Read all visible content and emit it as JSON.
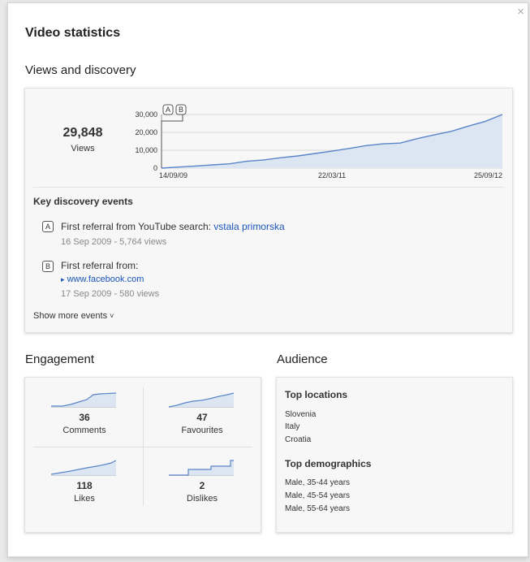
{
  "dialog": {
    "title": "Video statistics",
    "close_glyph": "×"
  },
  "views_section": {
    "heading": "Views and discovery",
    "views_count": "29,848",
    "views_label": "Views"
  },
  "chart_data": {
    "type": "area",
    "x_tick_labels": [
      "14/09/09",
      "22/03/11",
      "25/09/12"
    ],
    "y_tick_labels": [
      "0",
      "10,000",
      "20,000",
      "30,000"
    ],
    "ylim": [
      0,
      30000
    ],
    "x": [
      0,
      0.05,
      0.1,
      0.15,
      0.2,
      0.25,
      0.3,
      0.35,
      0.4,
      0.45,
      0.5,
      0.55,
      0.6,
      0.65,
      0.7,
      0.75,
      0.8,
      0.85,
      0.9,
      0.95,
      1.0
    ],
    "values": [
      0,
      600,
      1200,
      1800,
      2400,
      3800,
      4600,
      5800,
      6800,
      8200,
      9500,
      11000,
      12600,
      13600,
      14000,
      16500,
      18600,
      20600,
      23500,
      26200,
      30000
    ],
    "series_color": "#5a85c8",
    "fill_color": "#dce6f2",
    "markers": [
      "A",
      "B"
    ],
    "grid": true
  },
  "discovery": {
    "title": "Key discovery events",
    "events": [
      {
        "marker": "A",
        "text": "First referral from YouTube search: ",
        "link": "vstala primorska",
        "sub": "16 Sep 2009 - 5,764 views"
      },
      {
        "marker": "B",
        "text": "First referral from:",
        "link_arrow": "▸",
        "link": "www.facebook.com",
        "sub": "17 Sep 2009 - 580 views"
      }
    ],
    "show_more": "Show more events",
    "show_more_chevron": "˅"
  },
  "engagement": {
    "heading": "Engagement",
    "items": [
      {
        "value": "36",
        "label": "Comments"
      },
      {
        "value": "47",
        "label": "Favourites"
      },
      {
        "value": "118",
        "label": "Likes"
      },
      {
        "value": "2",
        "label": "Dislikes"
      }
    ]
  },
  "audience": {
    "heading": "Audience",
    "top_locations_title": "Top locations",
    "locations": [
      "Slovenia",
      "Italy",
      "Croatia"
    ],
    "top_demographics_title": "Top demographics",
    "demographics": [
      "Male, 35-44 years",
      "Male, 45-54 years",
      "Male, 55-64 years"
    ]
  },
  "colors": {
    "link": "#1a56b8",
    "line": "#5a85c8",
    "fill": "#dce6f2"
  }
}
